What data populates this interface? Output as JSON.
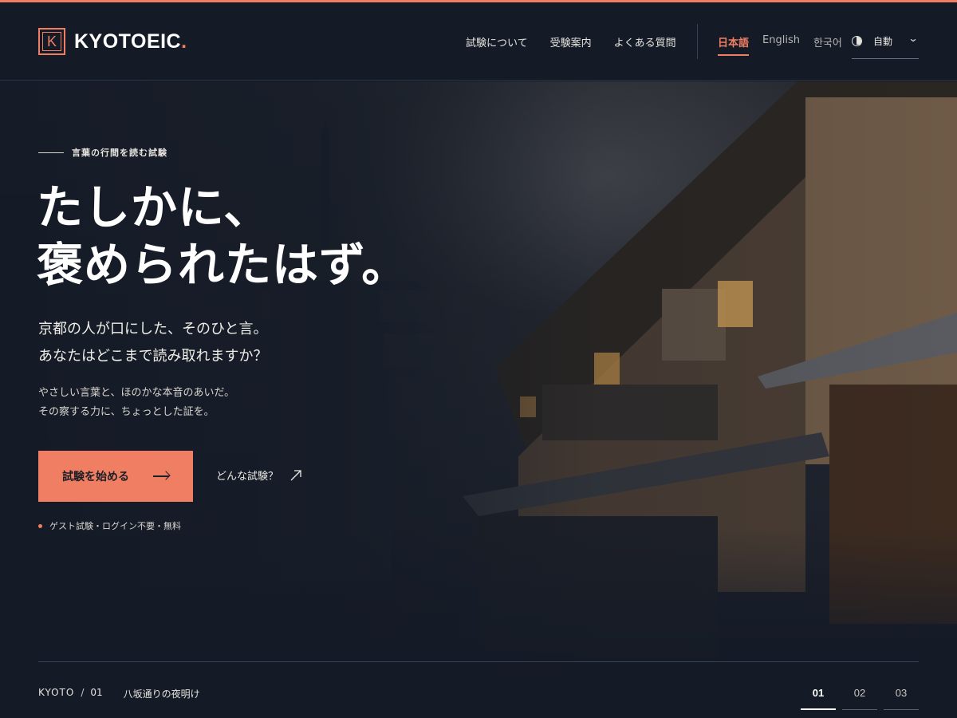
{
  "brand": {
    "name": "KYOTOEIC",
    "dot": ".",
    "mark": "K",
    "accent": "#f07e62"
  },
  "nav": {
    "items": [
      "試験について",
      "受験案内",
      "よくある質問"
    ]
  },
  "languages": [
    {
      "label": "日本語",
      "active": true
    },
    {
      "label": "English",
      "active": false
    },
    {
      "label": "한국어",
      "active": false
    }
  ],
  "theme": {
    "label": "自動",
    "icon": "contrast-icon"
  },
  "hero": {
    "eyebrow": "言葉の行間を読む試験",
    "headline": [
      "たしかに、",
      "褒められたはず。"
    ],
    "lead": [
      "京都の人が口にした、そのひと言。",
      "あなたはどこまで読み取れますか？"
    ],
    "body": [
      "やさしい言葉と、ほのかな本音のあいだ。",
      "その察する力に、ちょっとした証を。"
    ],
    "cta_label": "試験を始める",
    "secondary_label": "どんな試験？",
    "note": "ゲスト試験・ログイン不要・無料"
  },
  "slide": {
    "city": "KYOTO",
    "separator": "/",
    "index": "01",
    "title": "八坂通りの夜明け"
  },
  "pager": [
    {
      "label": "01",
      "active": true
    },
    {
      "label": "02",
      "active": false
    },
    {
      "label": "03",
      "active": false
    }
  ]
}
